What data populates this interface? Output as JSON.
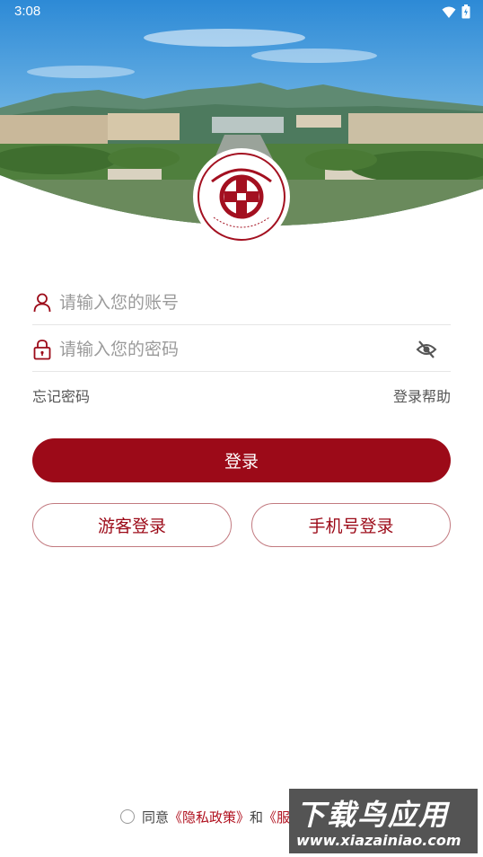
{
  "status": {
    "time": "3:08"
  },
  "logo": {
    "alt": "山东管理学院",
    "ring_text": "SHANDONG MANAGEMENT UNIVERSITY"
  },
  "form": {
    "account_placeholder": "请输入您的账号",
    "password_placeholder": "请输入您的密码",
    "forgot_password": "忘记密码",
    "login_help": "登录帮助",
    "login_button": "登录",
    "guest_login": "游客登录",
    "phone_login": "手机号登录"
  },
  "agreement": {
    "prefix": "同意",
    "privacy_policy": "《隐私政策》",
    "and": "和",
    "service_policy": "《服"
  },
  "watermark": {
    "title": "下载鸟应用",
    "url": "www.xiazainiao.com"
  },
  "colors": {
    "brand": "#9c0a18",
    "brand_outline": "#c27a80"
  },
  "icons": [
    "wifi-icon",
    "battery-icon",
    "user-icon",
    "lock-icon",
    "eye-off-icon",
    "radio-icon"
  ]
}
